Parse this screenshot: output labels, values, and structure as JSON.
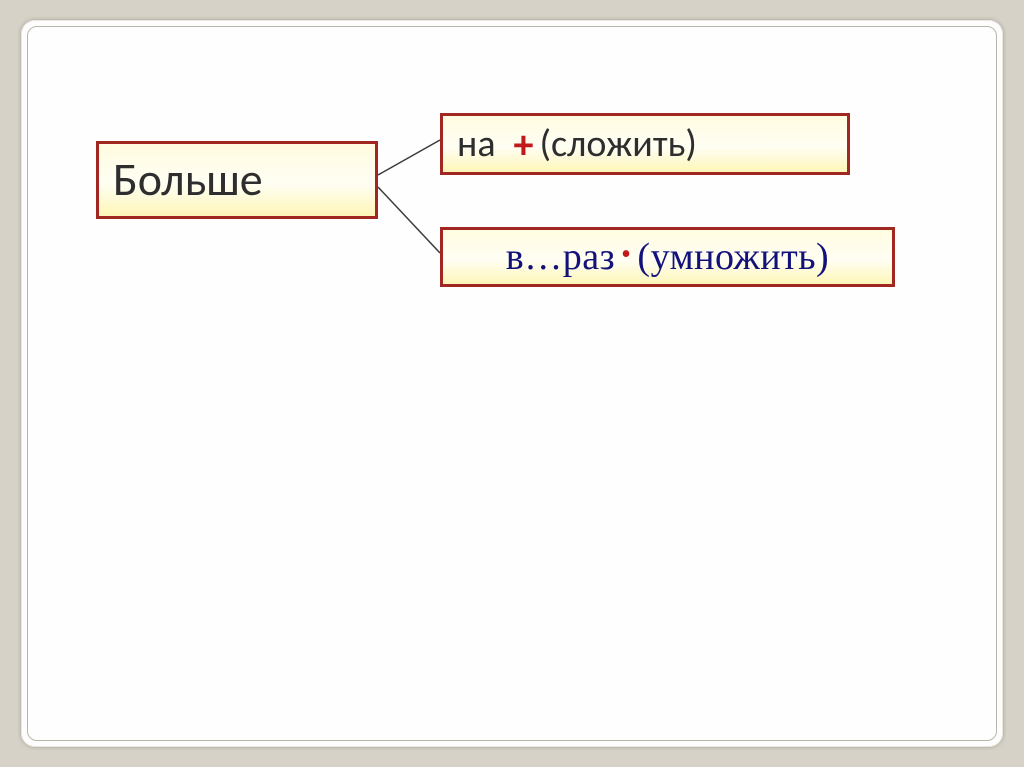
{
  "main": {
    "label": "Больше"
  },
  "branch_top": {
    "prefix": "на",
    "symbol": "+",
    "paren": "(сложить)"
  },
  "branch_bottom": {
    "prefix": "в…раз",
    "symbol": "•",
    "paren": "(умножить)"
  }
}
